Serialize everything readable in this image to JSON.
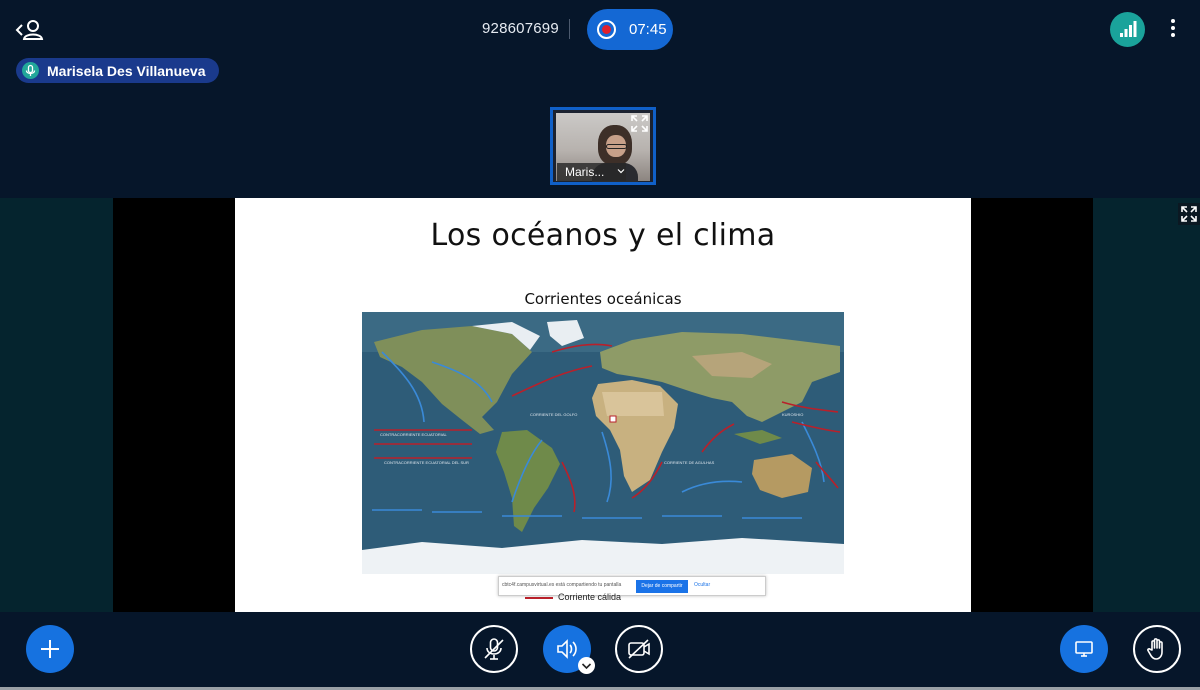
{
  "header": {
    "meeting_id": "928607699",
    "recording_time": "07:45",
    "icons": [
      "back-user-icon",
      "record-icon",
      "signal-strength-icon",
      "more-options-icon"
    ]
  },
  "active_speaker": {
    "name": "Marisela Des Villanueva",
    "icon": "microphone-icon"
  },
  "participant_thumbnail": {
    "label": "Maris..."
  },
  "slide": {
    "title": "Los océanos y el clima",
    "subtitle": "Corrientes oceánicas",
    "share_notice": "cbtc4f.campusvirtual.es está compartiendo tu pantalla",
    "share_stop_label": "Dejar de compartir",
    "share_hide_label": "Ocultar",
    "legend_label": "Corriente   cálida",
    "colors": {
      "ocean": "#2d5b76",
      "warm_current": "#b9202a",
      "cold_current": "#3a8ad8"
    }
  },
  "controls": {
    "add": "plus-icon",
    "microphone": "microphone-muted-icon",
    "speaker": "speaker-icon",
    "video": "video-off-icon",
    "share_screen": "screen-share-icon",
    "raise_hand": "raise-hand-icon"
  },
  "colors": {
    "primary": "#1672e0",
    "background": "#06162a",
    "accent_teal": "#1aa39b",
    "record_red": "#e0202c"
  }
}
